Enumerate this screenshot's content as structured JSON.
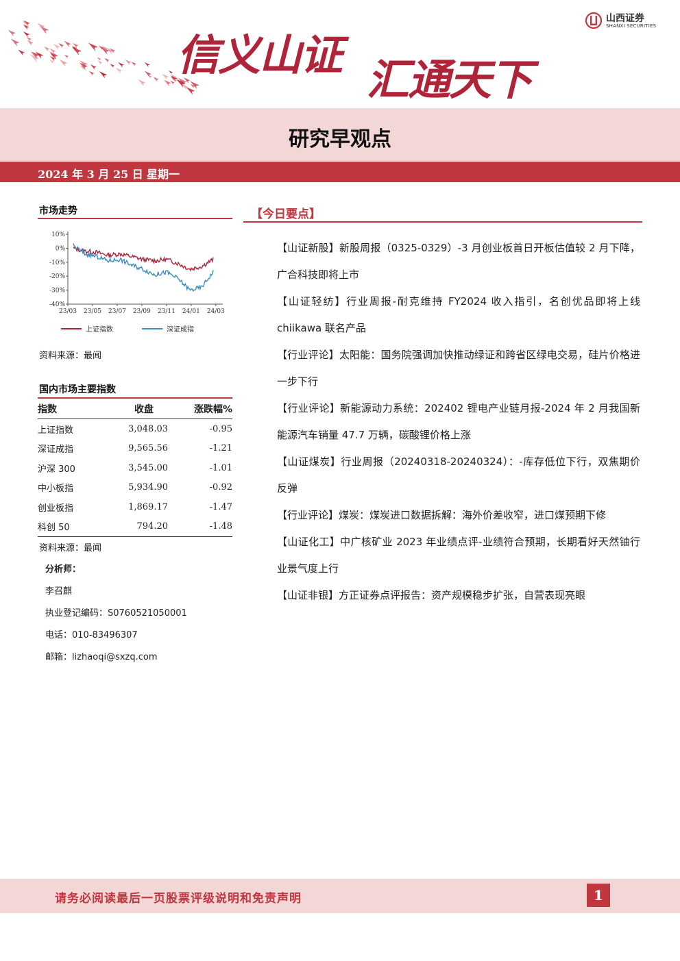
{
  "header": {
    "slogan_part1": "信义山证",
    "slogan_part2": "汇通天下",
    "logo_cn": "山西证券",
    "logo_en": "SHANXI SECURITIES",
    "brand_color": "#c0373f"
  },
  "report": {
    "title": "研究早观点",
    "date": "2024 年 3 月 25 日",
    "weekday": "星期一"
  },
  "market": {
    "section_title": "市场走势",
    "source": "资料来源：最闻"
  },
  "chart_data": {
    "type": "line",
    "x": [
      "23/03",
      "23/05",
      "23/07",
      "23/09",
      "23/11",
      "24/01",
      "24/03"
    ],
    "ytick_labels": [
      "10%",
      "0%",
      "-10%",
      "-20%",
      "-30%",
      "-40%"
    ],
    "ylim": [
      -40,
      10
    ],
    "series": [
      {
        "name": "上证指数",
        "color": "#b0243a",
        "values": [
          0,
          -2,
          -3,
          -5,
          -4,
          -6,
          -8,
          -9,
          -8,
          -11,
          -15,
          -13,
          -8
        ]
      },
      {
        "name": "深证成指",
        "color": "#3a8cc6",
        "values": [
          2,
          -4,
          -6,
          -9,
          -8,
          -12,
          -15,
          -19,
          -17,
          -22,
          -30,
          -28,
          -17
        ]
      }
    ]
  },
  "indices": {
    "section_title": "国内市场主要指数",
    "headers": [
      "指数",
      "收盘",
      "涨跌幅%"
    ],
    "rows": [
      [
        "上证指数",
        "3,048.03",
        "-0.95"
      ],
      [
        "深证成指",
        "9,565.56",
        "-1.21"
      ],
      [
        "沪深 300",
        "3,545.00",
        "-1.01"
      ],
      [
        "中小板指",
        "5,934.90",
        "-0.92"
      ],
      [
        "创业板指",
        "1,869.17",
        "-1.47"
      ],
      [
        "科创 50",
        "794.20",
        "-1.48"
      ]
    ],
    "source": "资料来源：最闻"
  },
  "analyst": {
    "label": "分析师：",
    "name": "李召麒",
    "license": "执业登记编码：S0760521050001",
    "phone": "电话：010-83496307",
    "email": "邮箱：lizhaoqi@sxzq.com"
  },
  "today": {
    "title": "【今日要点】",
    "points": [
      "【山证新股】新股周报（0325-0329）-3 月创业板首日开板估值较 2 月下降，广合科技即将上市",
      "【山证轻纺】行业周报-耐克维持 FY2024 收入指引，名创优品即将上线 chiikawa 联名产品",
      "【行业评论】太阳能：国务院强调加快推动绿证和跨省区绿电交易，硅片价格进一步下行",
      "【行业评论】新能源动力系统：202402 锂电产业链月报-2024 年 2 月我国新能源汽车销量 47.7 万辆，碳酸锂价格上涨",
      "【山证煤炭】行业周报（20240318-20240324）：-库存低位下行，双焦期价反弹",
      "【行业评论】煤炭：煤炭进口数据拆解：海外价差收窄，进口煤预期下修",
      "【山证化工】中广核矿业 2023 年业绩点评-业绩符合预期，长期看好天然铀行业景气度上行",
      "【山证非银】方正证券点评报告：资产规模稳步扩张，自营表现亮眼"
    ]
  },
  "footer": {
    "notice": "请务必阅读最后一页股票评级说明和免责声明",
    "page_number": "1"
  }
}
